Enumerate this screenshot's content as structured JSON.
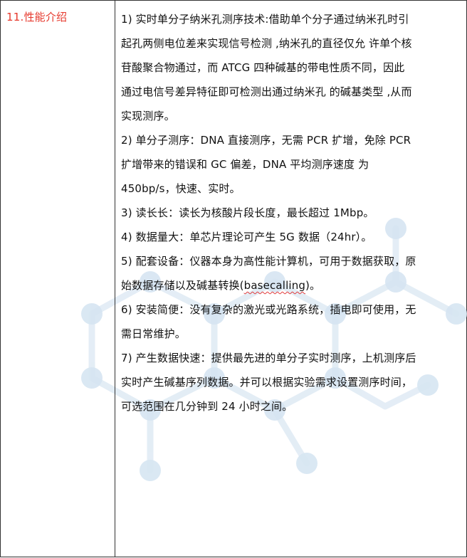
{
  "section": {
    "label": "11.性能介绍"
  },
  "paragraphs": [
    {
      "lines": [
        "1)  实时单分子纳米孔测序技术:借助单个分子通过纳米孔时引",
        "起孔两侧电位差来实现信号检测 ,纳米孔的直径仅允  许单个核",
        "苷酸聚合物通过，而  ATCG  四种碱基的带电性质不同，因此",
        "通过电信号差异特征即可检测出通过纳米孔  的碱基类型 ,从而",
        "实现测序。"
      ]
    },
    {
      "lines": [
        "2)  单分子测序：DNA 直接测序，无需  PCR  扩增，免除  PCR",
        "扩增带来的错误和  GC  偏差，DNA  平均测序速度  为",
        "450bp/s，快速、实时。"
      ]
    },
    {
      "lines": [
        "3)  读长长：读长为核酸片段长度，最长超过  1Mbp。"
      ]
    },
    {
      "lines": [
        "4)  数据量大：单芯片理论可产生  5G  数据（24hr）。"
      ]
    },
    {
      "lines_pre": "5)  配套设备：仪器本身为高性能计算机，可用于数据获取，原",
      "line2_before": "始数据存储以及碱基转换(",
      "line2_flagged": "basecalling",
      "line2_after": ")。"
    },
    {
      "lines": [
        "6)  安装简便：没有复杂的激光或光路系统，插电即可使用，无",
        "需日常维护。"
      ]
    },
    {
      "lines": [
        "7)  产生数据快速：提供最先进的单分子实时测序，上机测序后",
        "实时产生碱基序列数据。并可以根据实验需求设置测序时间，",
        "可选范围在几分钟到 24 小时之间。"
      ]
    }
  ],
  "colors": {
    "label": "#e6372b",
    "text": "#111111",
    "border": "#333333",
    "watermark": "#dbe8f3",
    "spellcheck": "#e23c3c"
  },
  "icons": {
    "watermark": "molecule-network-icon"
  }
}
